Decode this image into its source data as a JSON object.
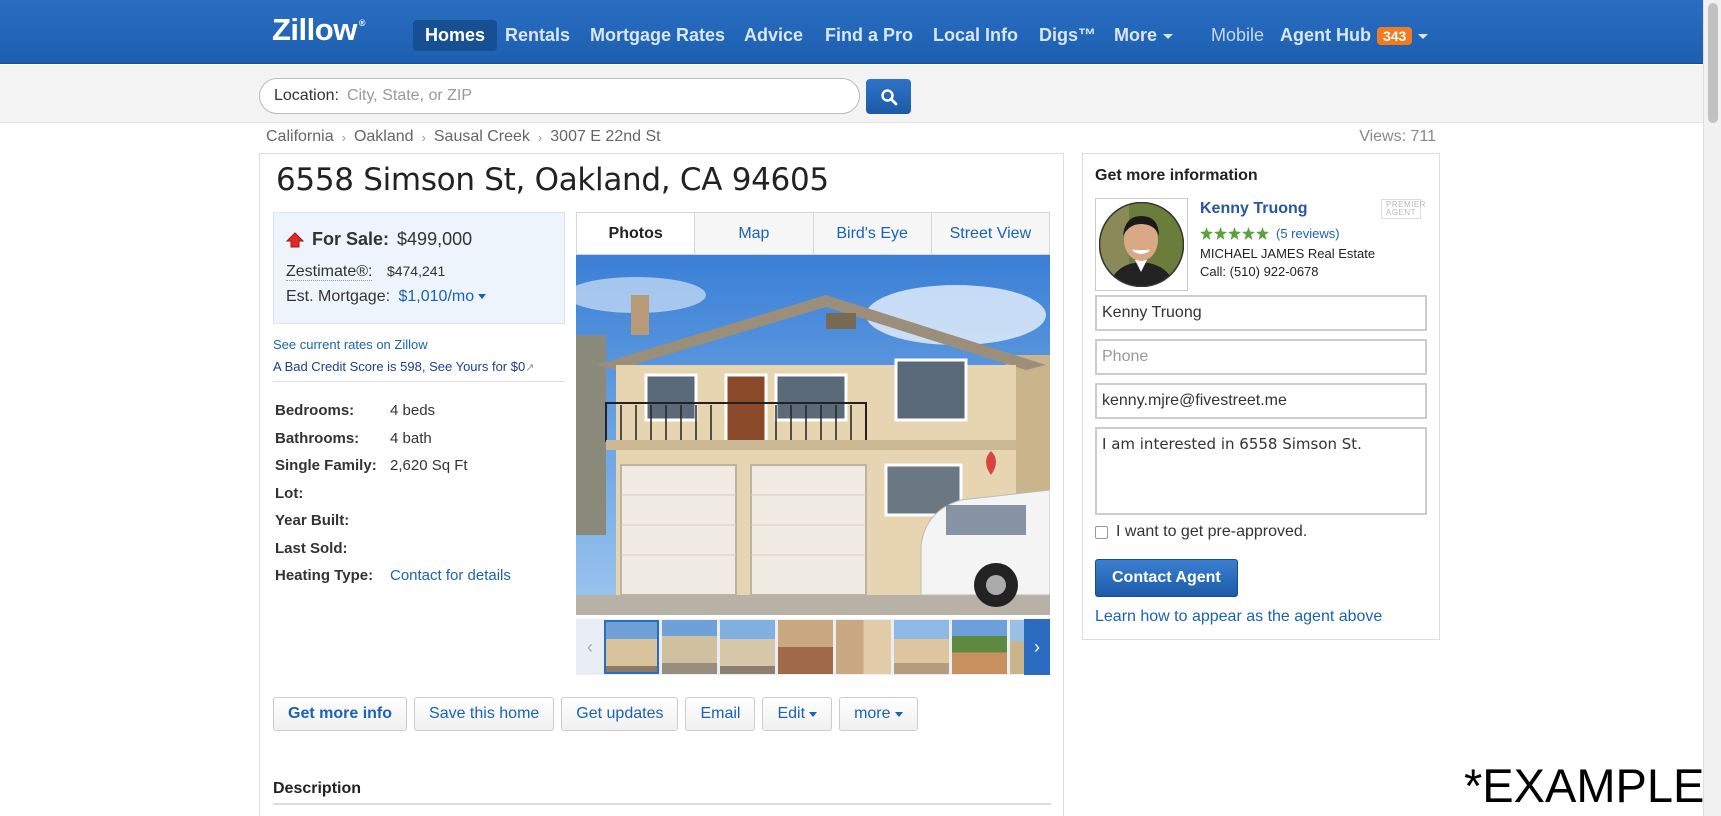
{
  "nav": {
    "logo": "Zillow",
    "items": [
      {
        "label": "Homes",
        "active": true
      },
      {
        "label": "Rentals"
      },
      {
        "label": "Mortgage Rates"
      },
      {
        "label": "Advice"
      },
      {
        "label": "Find a Pro"
      },
      {
        "label": "Local Info"
      },
      {
        "label": "Digs™"
      },
      {
        "label": "More"
      }
    ],
    "mobile": "Mobile",
    "agent_hub": "Agent Hub",
    "agent_hub_count": "343"
  },
  "search": {
    "label": "Location:",
    "placeholder": "City, State, or ZIP"
  },
  "breadcrumb": [
    "California",
    "Oakland",
    "Sausal Creek",
    "3007 E 22nd St"
  ],
  "views": "Views: 711",
  "listing": {
    "address": "6558 Simson St, Oakland, CA 94605",
    "for_sale_label": "For Sale:",
    "price": "$499,000",
    "zestimate_label": "Zestimate®:",
    "zestimate": "$474,241",
    "mortgage_label": "Est. Mortgage:",
    "mortgage": "$1,010/mo",
    "rate_link": "See current rates on Zillow",
    "credit_link": "A Bad Credit Score is 598, See Yours for $0",
    "facts": [
      {
        "key": "Bedrooms:",
        "value": "4 beds"
      },
      {
        "key": "Bathrooms:",
        "value": "4 bath"
      },
      {
        "key": "Single Family:",
        "value": "2,620 Sq Ft"
      },
      {
        "key": "Lot:",
        "value": ""
      },
      {
        "key": "Year Built:",
        "value": ""
      },
      {
        "key": "Last Sold:",
        "value": ""
      },
      {
        "key": "Heating Type:",
        "value": "Contact for details"
      }
    ],
    "tabs": [
      "Photos",
      "Map",
      "Bird's Eye",
      "Street View"
    ],
    "actions": [
      "Get more info",
      "Save this home",
      "Get updates",
      "Email",
      "Edit",
      "more"
    ],
    "description_title": "Description"
  },
  "agent": {
    "heading": "Get more information",
    "name": "Kenny Truong",
    "badge": "PREMIER AGENT",
    "reviews": "(5 reviews)",
    "rating": 5,
    "company": "MICHAEL JAMES Real Estate",
    "phone": "Call: (510) 922-0678",
    "form": {
      "name_value": "Kenny Truong",
      "phone_placeholder": "Phone",
      "email_value": "kenny.mjre@fivestreet.me",
      "message": "I am interested in 6558 Simson St."
    },
    "preapproved": "I want to get pre-approved.",
    "contact_button": "Contact Agent",
    "learn_link": "Learn how to appear as the agent above"
  },
  "watermark": "*EXAMPLE",
  "colors": {
    "nav": "#1d5fb0",
    "link": "#1a62b7",
    "badge": "#f27b1f",
    "stars": "#5aa33c"
  }
}
